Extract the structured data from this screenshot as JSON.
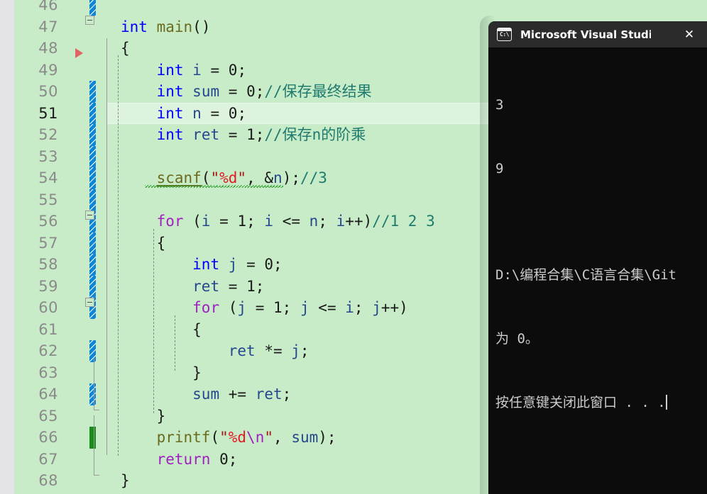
{
  "editor": {
    "background_color": "#c8ecc8",
    "gutter_color": "#e4e4e8",
    "first_visible_line": 46,
    "current_line": 51,
    "lines": [
      {
        "no": "46",
        "change": "blue",
        "text": ""
      },
      {
        "no": "47",
        "change": "none",
        "text": "int main()"
      },
      {
        "no": "48",
        "change": "none",
        "text": "{"
      },
      {
        "no": "49",
        "change": "none",
        "text": "    int i = 0;"
      },
      {
        "no": "50",
        "change": "blue",
        "text": "    int sum = 0;//保存最终结果"
      },
      {
        "no": "51",
        "change": "blue",
        "text": "    int n = 0;"
      },
      {
        "no": "52",
        "change": "blue",
        "text": "    int ret = 1;//保存n的阶乘"
      },
      {
        "no": "53",
        "change": "blue",
        "text": ""
      },
      {
        "no": "54",
        "change": "blue",
        "text": "    scanf(\"%d\", &n);//3"
      },
      {
        "no": "55",
        "change": "blue",
        "text": ""
      },
      {
        "no": "56",
        "change": "blue",
        "text": "    for (i = 1; i <= n; i++)//1 2 3"
      },
      {
        "no": "57",
        "change": "blue",
        "text": "    {"
      },
      {
        "no": "58",
        "change": "blue",
        "text": "        int j = 0;"
      },
      {
        "no": "59",
        "change": "blue",
        "text": "        ret = 1;"
      },
      {
        "no": "60",
        "change": "blue",
        "text": "        for (j = 1; j <= i; j++)"
      },
      {
        "no": "61",
        "change": "none",
        "text": "        {"
      },
      {
        "no": "62",
        "change": "blue",
        "text": "            ret *= j;"
      },
      {
        "no": "63",
        "change": "none",
        "text": "        }"
      },
      {
        "no": "64",
        "change": "blue",
        "text": "        sum += ret;"
      },
      {
        "no": "65",
        "change": "none",
        "text": "    }"
      },
      {
        "no": "66",
        "change": "green",
        "text": "    printf(\"%d\\n\", sum);"
      },
      {
        "no": "67",
        "change": "none",
        "text": "    return 0;"
      },
      {
        "no": "68",
        "change": "none",
        "text": "}"
      }
    ],
    "syntax_colors": {
      "keyword_type": "#0000ff",
      "keyword_control": "#a020c0",
      "function": "#6b6b20",
      "comment": "#1f7a6e",
      "string": "#a31515",
      "format_specifier": "#e01b24",
      "escape": "#a020c0",
      "plain": "#1a1a1a"
    },
    "markers": {
      "current_statement_arrow_line": "49",
      "fold_lines": [
        "47",
        "56",
        "60"
      ],
      "squiggle_lines": [
        "54"
      ]
    }
  },
  "console": {
    "title": "Microsoft Visual Studio 调试控",
    "icon": "cmd-icon",
    "close_label": "✕",
    "output_lines": [
      "3",
      "9",
      "",
      "D:\\编程合集\\C语言合集\\Git",
      "为 0。",
      "按任意键关闭此窗口 . . ."
    ],
    "background_color": "#0c0c0c",
    "titlebar_color": "#2b2b2b",
    "text_color": "#cccccc"
  }
}
